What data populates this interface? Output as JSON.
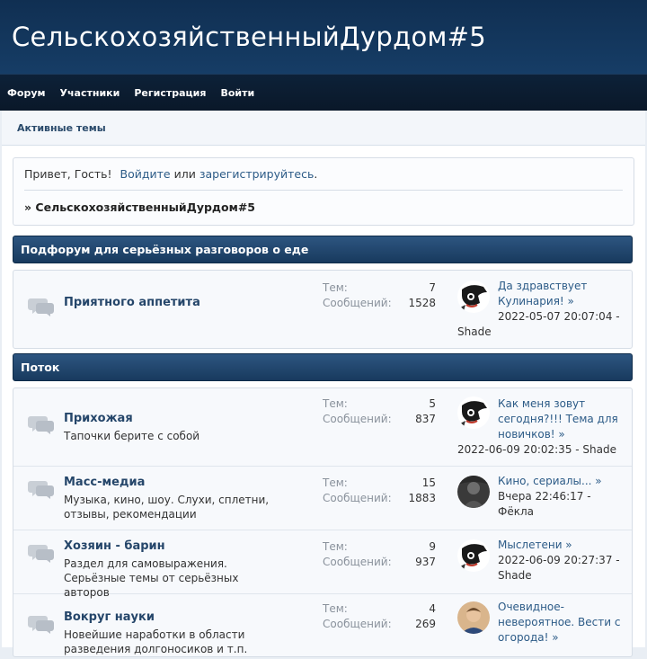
{
  "header": {
    "title": "СельскохозяйственныйДурдом#5"
  },
  "nav": [
    "Форум",
    "Участники",
    "Регистрация",
    "Войти"
  ],
  "subnav": {
    "active_topics": "Активные темы"
  },
  "welcome": {
    "greeting": "Привет, Гость!",
    "login": "Войдите",
    "or": "или",
    "register": "зарегистрируйтесь",
    "dot": ".",
    "crumb": "» СельскохозяйственныйДурдом#5"
  },
  "labels": {
    "topics": "Тем:",
    "posts": "Сообщений:"
  },
  "categories": [
    {
      "title": "Подфорум для серьёзных разговоров о еде",
      "forums": [
        {
          "name": "Приятного аппетита",
          "desc": "",
          "topics": "7",
          "posts": "1528",
          "last_topic": "Да здравствует Кулинария! »",
          "last_meta": "2022-05-07 20:07:04 -",
          "last_author": "Shade",
          "avatar": "shade-avatar"
        }
      ]
    },
    {
      "title": "Поток",
      "forums": [
        {
          "name": "Прихожая",
          "desc": "Тапочки берите с собой",
          "topics": "5",
          "posts": "837",
          "last_topic": "Как меня зовут сегодня?!!! Тема для новичков! »",
          "last_meta": "2022-06-09 20:02:35 - Shade",
          "last_author": "",
          "avatar": "shade-avatar"
        },
        {
          "name": "Масс-медиа",
          "desc": "Музыка, кино, шоу. Слухи, сплетни, отзывы, рекомендации",
          "topics": "15",
          "posts": "1883",
          "last_topic": "Кино, сериалы... »",
          "last_meta": "Вчера 22:46:17 -",
          "last_author": "Фёкла",
          "avatar": "fekla-avatar"
        },
        {
          "name": "Хозяин - барин",
          "desc": "Раздел для самовыражения. Серьёзные темы от серьёзных авторов",
          "topics": "9",
          "posts": "937",
          "last_topic": "Мыслетени »",
          "last_meta": "2022-06-09 20:27:37 -",
          "last_author": "Shade",
          "avatar": "shade-avatar"
        },
        {
          "name": "Вокруг науки",
          "desc": "Новейшие наработки в области разведения долгоносиков и т.п.",
          "topics": "4",
          "posts": "269",
          "last_topic": "Очевидное-невероятное. Вести с огорода! »",
          "last_meta": "",
          "last_author": "",
          "avatar": "man-avatar"
        }
      ]
    }
  ]
}
